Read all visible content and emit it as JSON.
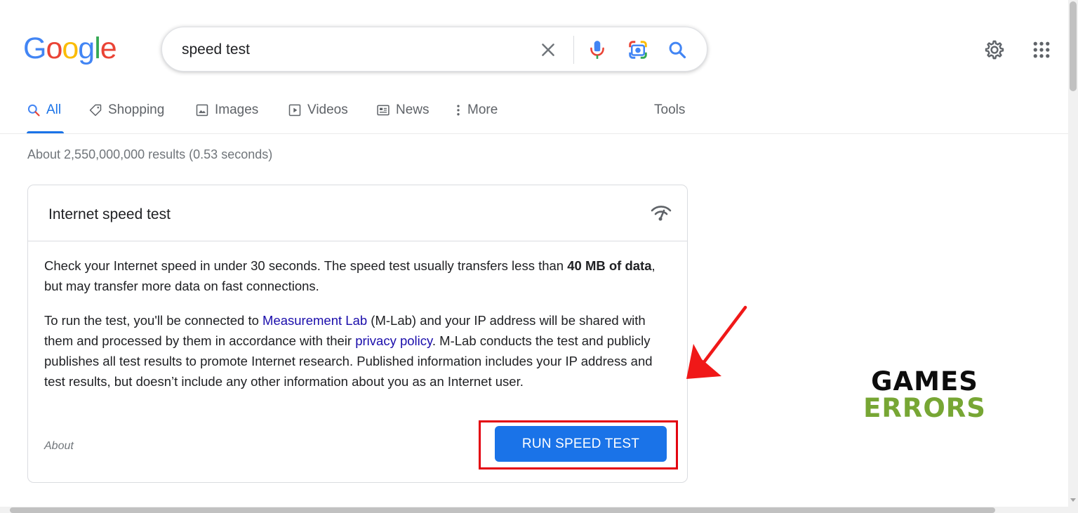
{
  "logo": {
    "letters": [
      "G",
      "o",
      "o",
      "g",
      "l",
      "e"
    ],
    "colors": [
      "#4285F4",
      "#EA4335",
      "#FBBC05",
      "#4285F4",
      "#34A853",
      "#EA4335"
    ]
  },
  "search": {
    "query": "speed test"
  },
  "tabs": [
    {
      "label": "All",
      "icon": "search-icon"
    },
    {
      "label": "Shopping",
      "icon": "tag-icon"
    },
    {
      "label": "Images",
      "icon": "image-icon"
    },
    {
      "label": "Videos",
      "icon": "play-icon"
    },
    {
      "label": "News",
      "icon": "news-icon"
    },
    {
      "label": "More",
      "icon": "vertical-dots-icon"
    }
  ],
  "tools_label": "Tools",
  "result_stats": "About 2,550,000,000 results (0.53 seconds)",
  "card": {
    "title": "Internet speed test",
    "p1_a": "Check your Internet speed in under 30 seconds. The speed test usually transfers less than ",
    "p1_bold": "40 MB of data",
    "p1_b": ", but may transfer more data on fast connections.",
    "p2_a": "To run the test, you'll be connected to ",
    "p2_link1": "Measurement Lab",
    "p2_b": " (M-Lab) and your IP address will be shared with them and processed by them in accordance with their ",
    "p2_link2": "privacy policy",
    "p2_c": ". M-Lab conducts the test and publicly publishes all test results to promote Internet research. Published information includes your IP address and test results, but doesn’t include any other information about you as an Internet user.",
    "about_label": "About",
    "button_label": "RUN SPEED TEST"
  },
  "watermark": {
    "line1": "GAMES",
    "line2": "ERRORS"
  },
  "colors": {
    "accent": "#1a73e8",
    "link": "#1a0dab",
    "highlight": "#e3000f",
    "watermark_green": "#77a634"
  }
}
